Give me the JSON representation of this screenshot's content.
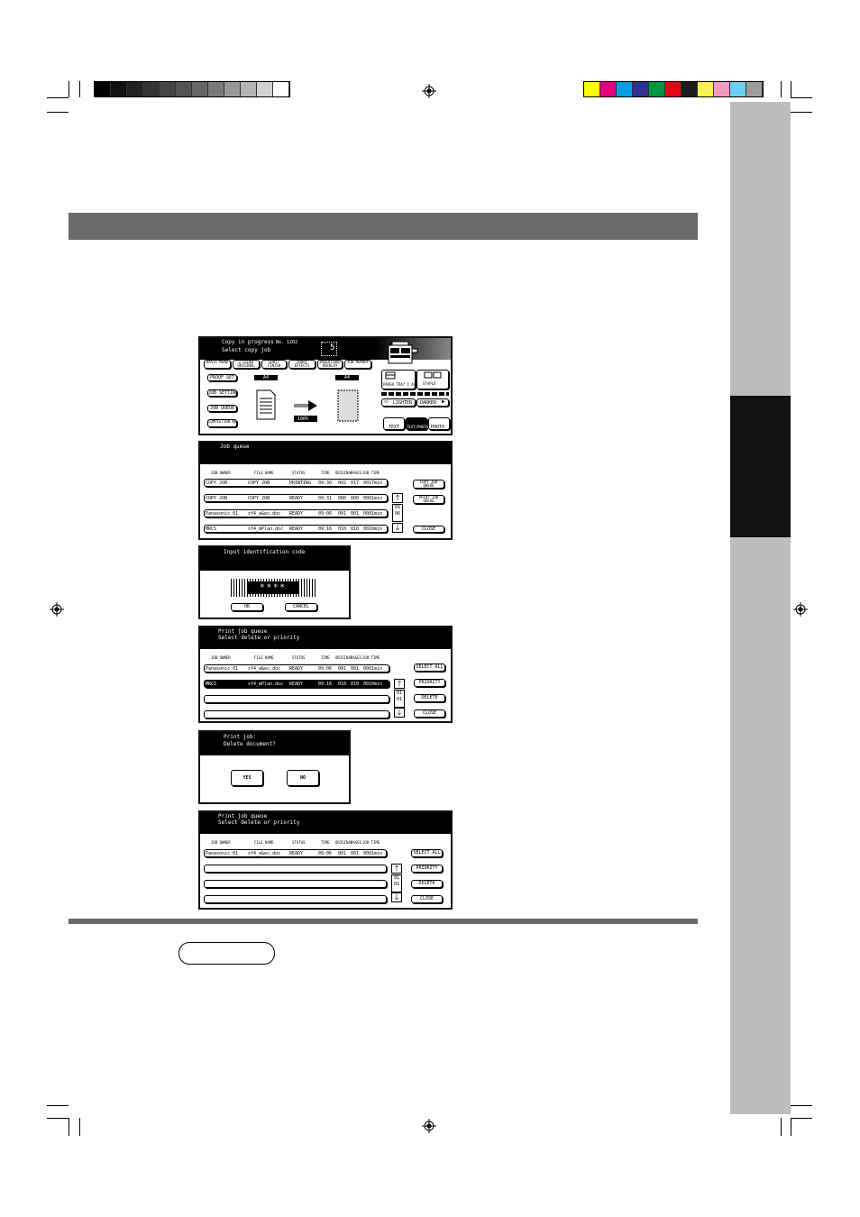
{
  "color_bars": {
    "gray": [
      "#000000",
      "#111111",
      "#222222",
      "#333333",
      "#444444",
      "#555555",
      "#666666",
      "#7a7a7a",
      "#999999",
      "#b4b4b4",
      "#d2d2d2",
      "#ffffff"
    ],
    "color": [
      "#ffff00",
      "#e6007e",
      "#009fe3",
      "#2e3192",
      "#009540",
      "#e30613",
      "#1d1d1b",
      "#fff14f",
      "#f49ac2",
      "#6dcff6",
      "#9d9d9c"
    ]
  },
  "screen1": {
    "title_line1": "Copy in progress",
    "job_no": "No. 1202",
    "title_line2": "Select copy job",
    "count": "5",
    "tabs": [
      "BASIC MENU",
      "2-SIDED ORIGINAL",
      "SORT/ FINISH",
      "ZOOM/ EFFECTS",
      "INSERTION/ OVERLAY",
      "JOB MEMORY"
    ],
    "side_buttons": [
      "PROOF SET",
      "JOB SETTINGS",
      "JOB QUEUE",
      "COMPLETION NOTICE"
    ],
    "paper_left": "A4",
    "paper_right": "A4",
    "zoom": "100%",
    "paper_tray": "PAPER TRAY 1 A4",
    "finish": "STAPLE",
    "lighter": "LIGHTER",
    "darker": "DARKER",
    "modes": [
      "TEXT",
      "TEXT/PHOTO",
      "PHOTO"
    ]
  },
  "screen2": {
    "title": "Job queue",
    "columns": [
      "JOB OWNER",
      "FILE NAME",
      "STATUS",
      "TIME",
      "ORIGINAL",
      "PAGES",
      "JOB TIME"
    ],
    "rows": [
      {
        "owner": "COPY JOB",
        "file": "COPY JOB",
        "status": "PRINTING",
        "time": "09:30",
        "orig": "002",
        "pages": "017",
        "jobtime": "0017min"
      },
      {
        "owner": "COPY JOB",
        "file": "COPY JOB",
        "status": "READY",
        "time": "09:31",
        "orig": "080",
        "pages": "000",
        "jobtime": "0001min"
      },
      {
        "owner": "Panasonic 01",
        "file": "sf4_a&ec.doc",
        "status": "READY",
        "time": "09:06",
        "orig": "001",
        "pages": "001",
        "jobtime": "0001min"
      },
      {
        "owner": "MRCS",
        "file": "sf4_mPlan.doc",
        "status": "READY",
        "time": "09:16",
        "orig": "010",
        "pages": "010",
        "jobtime": "0010min"
      }
    ],
    "page_top": "01",
    "page_bottom": "06",
    "buttons": [
      "COPY JOB QUEUE",
      "PRINT JOB QUEUE",
      "CLOSE"
    ]
  },
  "screen3": {
    "title": "Input identification code",
    "code": "****",
    "ok": "OK",
    "cancel": "CANCEL"
  },
  "screen4": {
    "title_line1": "Print job queue",
    "title_line2": "Select delete or priority",
    "columns": [
      "JOB OWNER",
      "FILE NAME",
      "STATUS",
      "TIME",
      "ORIGINAL",
      "PAGES",
      "JOB TIME"
    ],
    "rows": [
      {
        "owner": "Panasonic 01",
        "file": "sf4_a&ec.doc",
        "status": "READY",
        "time": "09:06",
        "orig": "001",
        "pages": "001",
        "jobtime": "0001min"
      },
      {
        "owner": "MRCS",
        "file": "sf4_mPlan.doc",
        "status": "READY",
        "time": "09:16",
        "orig": "010",
        "pages": "010",
        "jobtime": "0010min"
      }
    ],
    "page_top": "01",
    "page_bottom": "01",
    "buttons": [
      "SELECT ALL",
      "PRIORITY",
      "DELETE",
      "CLOSE"
    ]
  },
  "screen5": {
    "title_line1": "Print job:",
    "title_line2": "Delete document?",
    "yes": "YES",
    "no": "NO"
  },
  "screen6": {
    "title_line1": "Print job queue",
    "title_line2": "Select delete or priority",
    "columns": [
      "JOB OWNER",
      "FILE NAME",
      "STATUS",
      "TIME",
      "ORIGINAL",
      "PAGES",
      "JOB TIME"
    ],
    "rows": [
      {
        "owner": "Panasonic 01",
        "file": "sf4_a&ec.doc",
        "status": "READY",
        "time": "09:06",
        "orig": "001",
        "pages": "001",
        "jobtime": "0001min"
      }
    ],
    "page_top": "01",
    "page_bottom": "01",
    "buttons": [
      "SELECT ALL",
      "PRIORITY",
      "DELETE",
      "CLOSE"
    ]
  }
}
